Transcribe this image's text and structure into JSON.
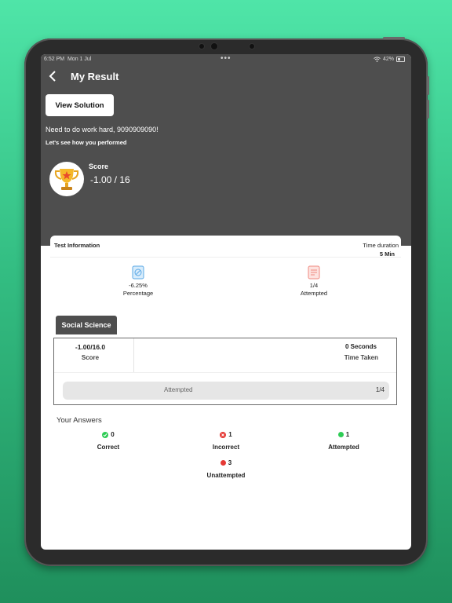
{
  "status_bar": {
    "time": "6:52 PM",
    "date": "Mon 1 Jul",
    "dots": "•••",
    "battery": "42%"
  },
  "header": {
    "back_icon": "chevron-left-icon",
    "title": "My Result"
  },
  "hero": {
    "view_solution_label": "View Solution",
    "message": "Need to do work hard, 9090909090!",
    "subtitle": "Let's see how you performed",
    "score_label": "Score",
    "score_value": "-1.00 / 16",
    "icon": "trophy-icon"
  },
  "test_info": {
    "title": "Test Information",
    "duration_label": "Time duration",
    "duration_value": "5 Min",
    "stats": [
      {
        "icon": "percentage-icon",
        "value": "-6.25%",
        "label": "Percentage",
        "color": "#5aa8e6"
      },
      {
        "icon": "attempted-icon",
        "value": "1/4",
        "label": "Attempted",
        "color": "#f08a80"
      }
    ]
  },
  "subject": {
    "tab_label": "Social Science",
    "score_value": "-1.00/16.0",
    "score_label": "Score",
    "time_value": "0 Seconds",
    "time_label": "Time Taken",
    "attempted_label": "Attempted",
    "attempted_value": "1/4"
  },
  "answers": {
    "title": "Your Answers",
    "items": [
      {
        "count": "0",
        "label": "Correct",
        "icon": "check-circle-icon",
        "color": "#2ecc55"
      },
      {
        "count": "1",
        "label": "Incorrect",
        "icon": "cross-circle-icon",
        "color": "#e53935"
      },
      {
        "count": "1",
        "label": "Attempted",
        "icon": "green-dot-icon",
        "color": "#2ecc55"
      },
      {
        "count": "3",
        "label": "Unattempted",
        "icon": "red-dot-icon",
        "color": "#e53935"
      }
    ]
  }
}
